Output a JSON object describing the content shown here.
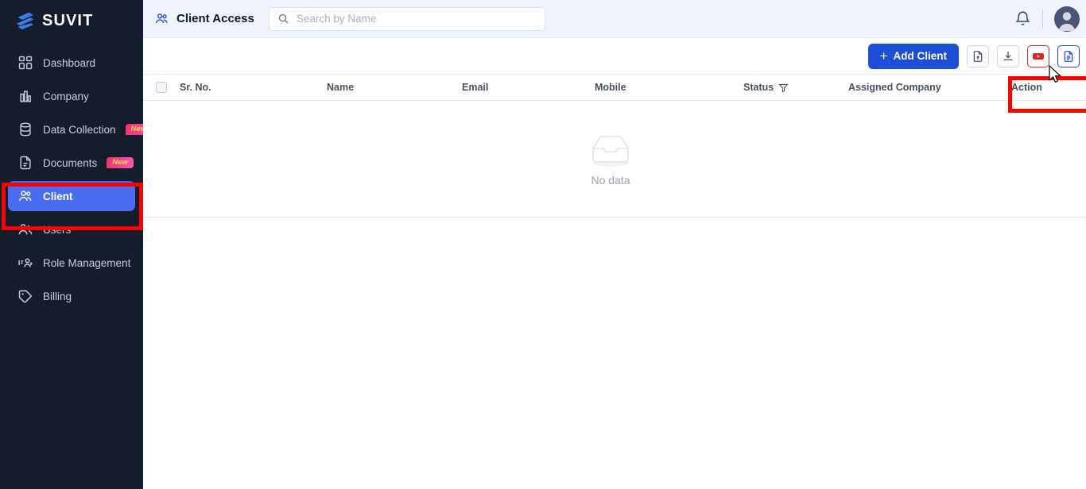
{
  "brand": {
    "name": "SUVIT",
    "logo_icon": "suvit-logo-icon"
  },
  "sidebar": {
    "items": [
      {
        "label": "Dashboard",
        "icon": "grid-icon",
        "badge": "",
        "active": false
      },
      {
        "label": "Company",
        "icon": "building-icon",
        "badge": "",
        "active": false
      },
      {
        "label": "Data Collection",
        "icon": "database-icon",
        "badge": "New",
        "active": false
      },
      {
        "label": "Documents",
        "icon": "document-icon",
        "badge": "New",
        "active": false
      },
      {
        "label": "Client",
        "icon": "clients-icon",
        "badge": "",
        "active": true
      },
      {
        "label": "Users",
        "icon": "users-icon",
        "badge": "",
        "active": false
      },
      {
        "label": "Role Management",
        "icon": "role-icon",
        "badge": "",
        "active": false
      },
      {
        "label": "Billing",
        "icon": "tag-icon",
        "badge": "",
        "active": false
      }
    ],
    "active_index": 4
  },
  "header": {
    "title": "Client Access",
    "title_icon": "clients-icon",
    "search": {
      "value": "",
      "placeholder": "Search by Name",
      "icon": "search-icon"
    },
    "notification_icon": "bell-icon",
    "avatar_icon": "user-avatar"
  },
  "toolbar": {
    "add_client_label": "Add Client",
    "add_client_plus": "+",
    "icon_buttons": [
      {
        "name": "file-upload-icon",
        "color": "#3f4a63"
      },
      {
        "name": "download-icon",
        "color": "#3f4a63"
      },
      {
        "name": "youtube-icon",
        "color": "#e02424"
      },
      {
        "name": "document-icon",
        "color": "#1d4ed8"
      }
    ]
  },
  "table": {
    "columns": [
      {
        "label": "Sr. No."
      },
      {
        "label": "Name"
      },
      {
        "label": "Email"
      },
      {
        "label": "Mobile"
      },
      {
        "label": "Status",
        "icon": "filter-icon"
      },
      {
        "label": "Assigned Company"
      },
      {
        "label": "Action"
      }
    ],
    "rows": [],
    "empty_state": {
      "text": "No data",
      "icon": "empty-inbox-icon"
    }
  },
  "annotations": [
    {
      "name": "highlight-client-nav",
      "color": "#fe0000"
    },
    {
      "name": "highlight-add-client",
      "color": "#fe0000"
    }
  ],
  "colors": {
    "sidebar_bg": "#151c2c",
    "accent_blue": "#4a6cf0",
    "primary_button": "#1d4ed8",
    "header_bg": "#eef3fc",
    "annotation_red": "#fe0000"
  }
}
